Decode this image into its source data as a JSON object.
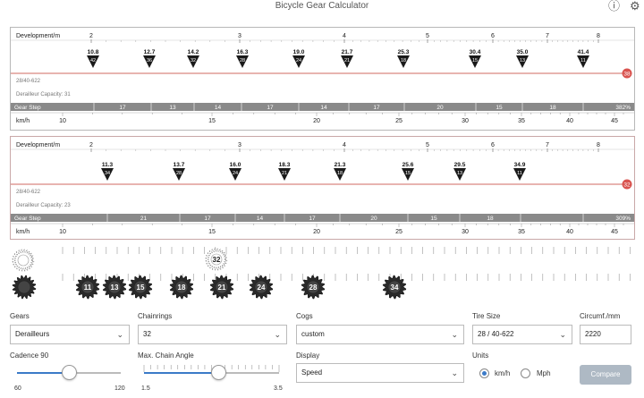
{
  "window": {
    "title": "Bicycle Gear Calculator",
    "help_icon": "help-icon",
    "settings_icon": "gear-icon"
  },
  "panels": [
    {
      "dev_label": "Development/m",
      "dev_ticks": [
        "2",
        "3",
        "4",
        "5",
        "6",
        "7",
        "8"
      ],
      "gears": [
        {
          "dev": "10.8",
          "cog": "42"
        },
        {
          "dev": "12.7",
          "cog": "36"
        },
        {
          "dev": "14.2",
          "cog": "32"
        },
        {
          "dev": "16.3",
          "cog": "28"
        },
        {
          "dev": "19.0",
          "cog": "24"
        },
        {
          "dev": "21.7",
          "cog": "21"
        },
        {
          "dev": "25.3",
          "cog": "18"
        },
        {
          "dev": "30.4",
          "cog": "15"
        },
        {
          "dev": "35.0",
          "cog": "13"
        },
        {
          "dev": "41.4",
          "cog": "11"
        }
      ],
      "chainring": "38",
      "info": "28/40-622",
      "capacity": "Derailleur Capacity: 31",
      "step_label": "Gear Step",
      "steps": [
        "17",
        "13",
        "14",
        "17",
        "14",
        "17",
        "20",
        "15",
        "18"
      ],
      "range": "382%",
      "speed_label": "km/h",
      "speed_ticks": [
        "10",
        "15",
        "20",
        "25",
        "30",
        "35",
        "40",
        "45"
      ],
      "accent": "#c0392b"
    },
    {
      "dev_label": "Development/m",
      "dev_ticks": [
        "2",
        "3",
        "4",
        "5",
        "6",
        "7",
        "8"
      ],
      "gears": [
        {
          "dev": "11.3",
          "cog": "34"
        },
        {
          "dev": "13.7",
          "cog": "28"
        },
        {
          "dev": "16.0",
          "cog": "24"
        },
        {
          "dev": "18.3",
          "cog": "21"
        },
        {
          "dev": "21.3",
          "cog": "18"
        },
        {
          "dev": "25.6",
          "cog": "15"
        },
        {
          "dev": "29.5",
          "cog": "13"
        },
        {
          "dev": "34.9",
          "cog": "11"
        }
      ],
      "chainring": "32",
      "info": "28/40-622",
      "capacity": "Derailleur Capacity: 23",
      "step_label": "Gear Step",
      "steps": [
        "21",
        "17",
        "14",
        "17",
        "20",
        "15",
        "18"
      ],
      "range": "309%",
      "speed_label": "km/h",
      "speed_ticks": [
        "10",
        "15",
        "20",
        "25",
        "30",
        "35",
        "40",
        "45"
      ],
      "accent": "#c0392b"
    }
  ],
  "selector": {
    "chainring_selected": "32",
    "cogs": [
      "11",
      "13",
      "15",
      "18",
      "21",
      "24",
      "28",
      "34"
    ]
  },
  "controls": {
    "gears_label": "Gears",
    "gears_value": "Derailleurs",
    "chainrings_label": "Chainrings",
    "chainrings_value": "32",
    "cogs_label": "Cogs",
    "cogs_value": "custom",
    "tire_label": "Tire Size",
    "tire_value": "28 / 40-622",
    "circ_label": "Circumf./mm",
    "circ_value": "2220",
    "cadence_label": "Cadence 90",
    "cadence_value": 90,
    "cadence_min": "60",
    "cadence_max": "120",
    "angle_label": "Max. Chain Angle",
    "angle_value": 2.6,
    "angle_min": "1.5",
    "angle_max": "3.5",
    "display_label": "Display",
    "display_value": "Speed",
    "units_label": "Units",
    "unit_kmh": "km/h",
    "unit_mph": "Mph",
    "unit_selected": "km/h",
    "compare_label": "Compare"
  },
  "colors": {
    "bar": "#8a8a8a",
    "accent_line": "#c0392b",
    "slider": "#3b7ac8"
  }
}
